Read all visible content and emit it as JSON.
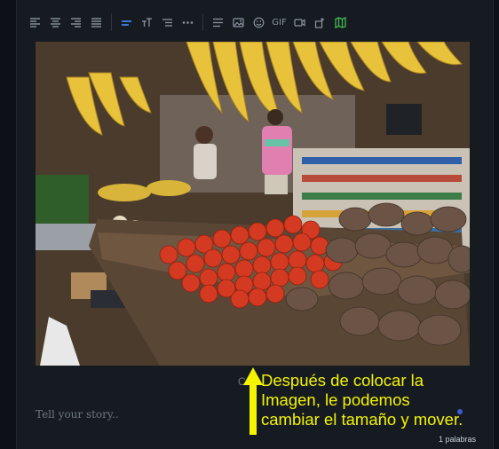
{
  "toolbar": {
    "icons": [
      "align-left-icon",
      "align-center-icon",
      "align-right-icon",
      "align-justify-icon",
      "heading-icon",
      "text-size-icon",
      "list-icon",
      "more-icon",
      "paragraph-icon",
      "image-icon",
      "emoji-icon",
      "gif-icon",
      "video-icon",
      "embed-icon",
      "map-icon"
    ],
    "gif_label": "GIF"
  },
  "colors": {
    "accent_blue": "#4c8dff",
    "annotation_yellow": "#f4f400",
    "map_green": "#3fb950"
  },
  "editor": {
    "placeholder": "Tell your story..",
    "caption_stub": "C",
    "word_count": "1 palabras"
  },
  "annotation": {
    "text": "Después de colocar la\nImagen, le podemos\ncambiar el tamaño y mover."
  }
}
